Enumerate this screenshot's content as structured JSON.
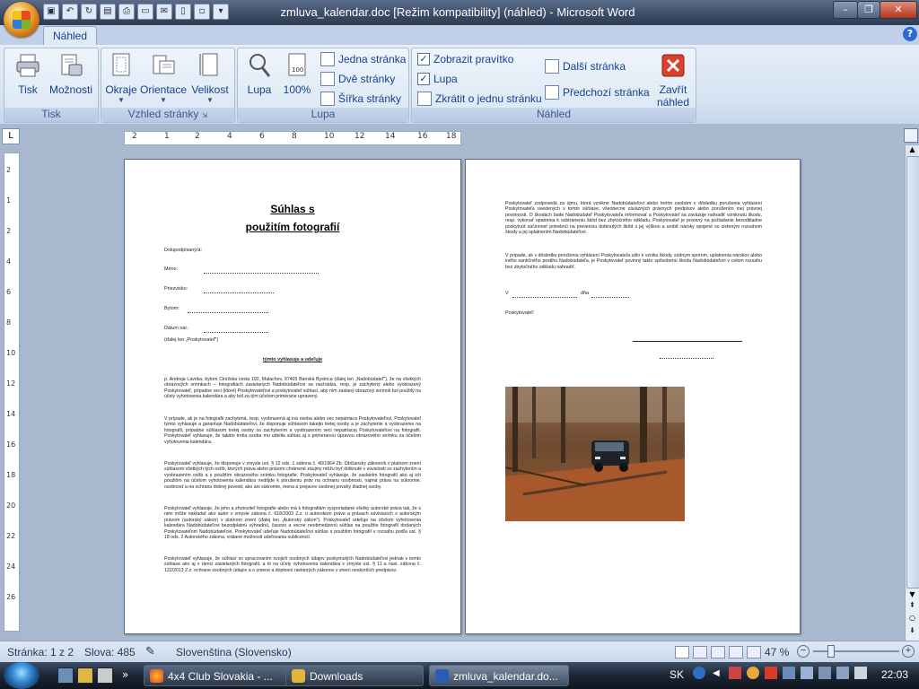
{
  "window": {
    "title": "zmluva_kalendar.doc [Režim kompatibility] (náhled) - Microsoft Word"
  },
  "ribbon": {
    "tab": "Náhled",
    "groups": {
      "tisk": {
        "label": "Tisk",
        "print": "Tisk",
        "options": "Možnosti"
      },
      "page_setup": {
        "label": "Vzhled stránky",
        "margins": "Okraje",
        "orientation": "Orientace",
        "size": "Velikost"
      },
      "zoom": {
        "label": "Lupa",
        "zoom": "Lupa",
        "percent": "100%",
        "one_page": "Jedna stránka",
        "two_pages": "Dvě stránky",
        "page_width": "Šířka stránky"
      },
      "preview": {
        "label": "Náhled",
        "show_ruler": "Zobrazit pravítko",
        "magnifier": "Lupa",
        "shrink": "Zkrátit o jednu stránku",
        "next_page": "Další stránka",
        "prev_page": "Předchozí stránka",
        "close_1": "Zavřít",
        "close_2": "náhled"
      }
    }
  },
  "ruler": {
    "h_labels": [
      "2",
      "1",
      "2",
      "4",
      "6",
      "8",
      "10",
      "12",
      "14",
      "16",
      "18"
    ],
    "v_labels": [
      "2",
      "1",
      "2",
      "4",
      "6",
      "8",
      "10",
      "12",
      "14",
      "16",
      "18",
      "20",
      "22",
      "24",
      "26"
    ]
  },
  "document": {
    "page1": {
      "title_line1": "Súhlas s",
      "title_line2": "použitím fotografií",
      "undersigned": "Dolupodpísaný/á:",
      "fields": [
        {
          "label": "Meno:"
        },
        {
          "label": "Priezvisko:"
        },
        {
          "label": "Bytom:"
        },
        {
          "label": "Dátum nar.:"
        }
      ],
      "hereinafter": "(ďalej len „Poskytovateľ\")",
      "heading": "týmto vyhlasuje a udeľuje",
      "p1": "p. Andreja Lavrikа, bytom Cinížska cesta 192, Malachov, 97405 Banská Bystrica (ďalej len „Nadobúdateľ\"), že na všetkých obrazových snímkach – fotografiách zasielaných Nadobúdateľovi sa nachádza, resp. je zachytený alebo vyobrazený Poskytovateľ, prípadne veci (ktoré) Poskytovateľovi a poskytovateľ súhlasí, aby ním zaslaný obrazový snímok bol použitý na účely vyhotovenia kalendára a aby bol za tým účelom primerane upravený.",
      "p2": "V prípade, ak je na fotografii zachytená, resp. vyobrazená aj iná osoba alebo vec nepatriaca Poskytovateľovi, Poskytovateľ týmto vyhlasuje a garantuje Nadobúdateľovi, že disponuje súhlasom takejto tretej osoby a je zachytenie a vyobrazenie na fotografii, prípadne súhlasom tretej osoby so zachytením a vyobrazením veci nepatriacej Poskytovateľovi na fotografii. Poskytovateľ vyhlasuje, že takáto tretia osoba mu udelila súhlas aj s primeranou úpravou obrazového snímku za účelom vyhotovenia kalendára.",
      "p3": "Poskytovateľ vyhlasuje, že disponuje v zmysle ust. § 12 ods. 1 zákona č. 40/1964 Zb. Občiansky zákonník v platnom znení súhlasom všetkých tých osôb, ktorých práva alebo právom chránené záujmy môžu byť dotknuté v súvislosti so zachytením a vyobrazením osôb a s použitím obrazového snímku fotografie. Poskytovateľ vyhlasuje, že zaslaním fotografií ako aj ich použitím na účelom vyhotovenia kalendára nedôjde k porušeniu práv na ochranu osobnosti, najmä práva na súkromie, osobnosť a na ochranu dobrej povesti, ako ani súkromie, mena a prejavov osobnej povahy žiadnej osoby.",
      "p4": "Poskytovateľ vyhlasuje, že jeho a zhotoviteľ fotografie alebo má k fotografiám vysporiadané všetky autorské práva tak, že s nimi môže nakladať ako autor v zmysle zákona č. 618/2003 Z.z. o autorskom práve a právach súvisiacich s autorským právom (autorský zákon) v platnom znení (ďalej len „Autorský zákon\"). Poskytovateľ udeľuje na účelom vyhotovenia kalendára Nadobúdateľovi bezodplatnú výhradnú, časovo a vecne neobmedzenú súhlas na použitie fotografií dodaných Poskytovateľom Nadobúdateľovi. Poskytovateľ udeľuje Nadobúdateľovi súhlas s použitím fotografií v rozsahu podľa ust. § 18 ods. 2 Autorského zákona, vrátane možnosti udeľovania sublicencií.",
      "p5": "Poskytovateľ vyhlasuje, že súhlasí so spracovaním svojich osobných údajov poskytnutých Nadobúdateľovi jednak v tomto súhlase ako aj v rámci zasielaných fotografií, a to na účely vyhotovenia kalendára v zmysle ust. § 11 a nasl. zákona č. 122/2013 Z.z. ochrane osobných údajov a o zmene a doplnení niektorých zákonov v znení neskorších predpisov."
    },
    "page2": {
      "p1": "Poskytovateľ zodpovedá za újmu, ktorá vznikne Nadobúdateľovi alebo tretím osobám v dôsledku porušenia vyhlásení Poskytovateľa uvedených v tomto súhlase, všeobecne záväzných právnych predpisov alebo porušením inej právnej povinnosti. O škodách bude Nadobúdateľ Poskytovateľa informovať a Poskytovateľ sa zaväzuje nahradiť vzniknutú škodu, resp. vykonať opatrenia k odstráneniu škôd bez zbytočného odkladu. Poskytovateľ je povinný na požiadanie bezodkladne poskytnúť súčinnosť potrebnú na prevenciu dotknutých škôd s jej výškou a urobiť nároky spojené so zisteným rozsahom škody a jej uplatnením Nadobúdateľovi.",
      "p2": "V prípade, ak v dôsledku porušenia vyhlásení Poskytovateľa ušlo k vzniku škody, súdnym sporom, uplatnenia nárokov alebo iného sankčného postihu Nadobúdateľa, je Poskytovateľ povinný takto spôsobenú škodu Nadobúdateľovi v celom rozsahu bez zbytočného odkladu nahradiť.",
      "place_prefix": "V",
      "date_prefix": "dňa",
      "provider": "Poskytovateľ:"
    }
  },
  "status": {
    "page": "Stránka: 1 z 2",
    "words": "Slova: 485",
    "language": "Slovenština (Slovensko)",
    "zoom": "47 %"
  },
  "taskbar": {
    "tasks": [
      "4x4 Club Slovakia - ...",
      "Downloads",
      "zmluva_kalendar.do..."
    ],
    "lang": "SK",
    "time": "22:03"
  }
}
